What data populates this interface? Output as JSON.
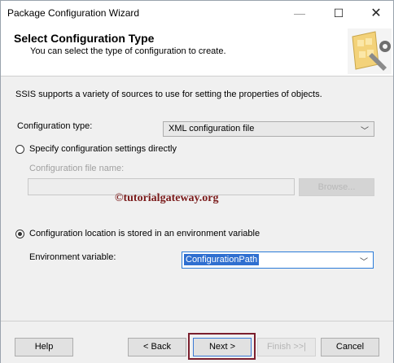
{
  "window": {
    "title": "Package Configuration Wizard",
    "controls": {
      "minimize": "—",
      "maximize": "☐",
      "close": "✕"
    }
  },
  "header": {
    "title": "Select Configuration Type",
    "subtitle": "You can select the type of configuration to create.",
    "logo_icon": "wizard-tools-icon"
  },
  "content": {
    "intro": "SSIS supports a variety of sources to use for setting the properties of objects.",
    "config_type": {
      "label": "Configuration type:",
      "value": "XML configuration file"
    },
    "option_direct": {
      "label": "Specify configuration settings directly",
      "selected": false
    },
    "config_file": {
      "label": "Configuration file name:",
      "value": "",
      "browse_label": "Browse..."
    },
    "watermark": "©tutorialgateway.org",
    "option_env": {
      "label": "Configuration location is stored in an environment variable",
      "selected": true
    },
    "env_var": {
      "label": "Environment variable:",
      "value": "ConfigurationPath"
    }
  },
  "footer": {
    "help": "Help",
    "back": "< Back",
    "next": "Next >",
    "finish": "Finish >>|",
    "cancel": "Cancel"
  },
  "colors": {
    "highlight": "#7b1f2e",
    "selection": "#2f6fd0"
  }
}
